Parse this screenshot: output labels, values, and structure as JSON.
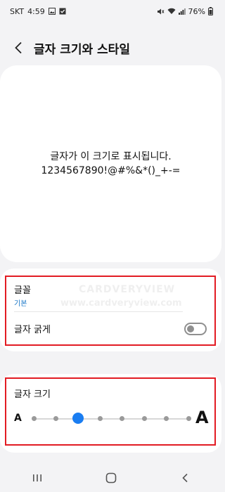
{
  "status_bar": {
    "carrier": "SKT",
    "time": "4:59",
    "battery": "76%",
    "icons_left": [
      "image-icon",
      "check-box-icon"
    ],
    "icons_right": [
      "mute-icon",
      "wifi-icon",
      "signal-icon",
      "battery-icon"
    ]
  },
  "header": {
    "title": "글자 크기와 스타일",
    "back_icon": "chevron-left-icon"
  },
  "preview": {
    "line1": "글자가 이 크기로 표시됩니다.",
    "line2": "1234567890!@#%&*()_+-="
  },
  "settings": {
    "font_label": "글꼴",
    "font_value": "기본",
    "bold_label": "글자 굵게",
    "bold_enabled": false
  },
  "font_size": {
    "label": "글자 크기",
    "small_glyph": "A",
    "large_glyph": "A",
    "steps": 8,
    "selected_step": 3
  },
  "watermark": {
    "line1": "CARDVERYVIEW",
    "line2": "www.cardveryview.com"
  },
  "nav_bar": {
    "items": [
      "recents-icon",
      "home-icon",
      "back-icon"
    ]
  },
  "colors": {
    "accent": "#1a7df1",
    "highlight": "#e21b23",
    "link": "#1c79c8"
  }
}
